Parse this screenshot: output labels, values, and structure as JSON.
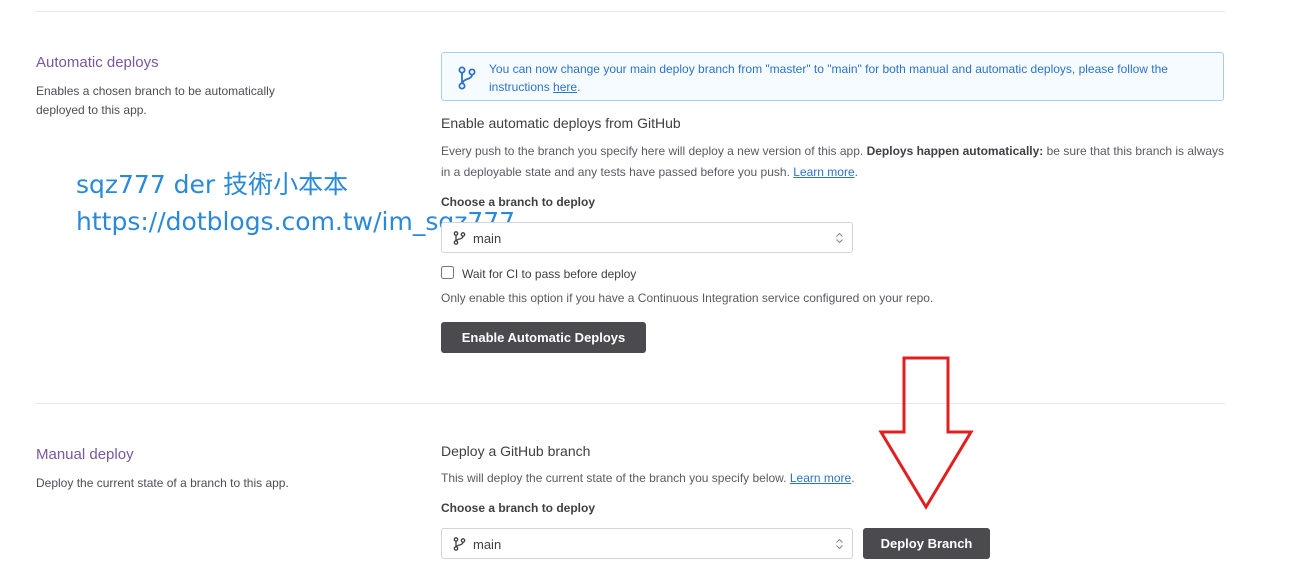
{
  "automatic": {
    "title": "Automatic deploys",
    "description": "Enables a chosen branch to be automatically deployed to this app.",
    "info": {
      "text": "You can now change your main deploy branch from \"master\" to \"main\" for both manual and automatic deploys, please follow the instructions ",
      "link": "here",
      "end": "."
    },
    "heading": "Enable automatic deploys from GitHub",
    "paragraph": {
      "text1": "Every push to the branch you specify here will deploy a new version of this app. ",
      "bold": "Deploys happen automatically:",
      "text2": " be sure that this branch is always in a deployable state and any tests have passed before you push. ",
      "link": "Learn more",
      "end": "."
    },
    "branch_label": "Choose a branch to deploy",
    "branch_value": "main",
    "checkbox_label": "Wait for CI to pass before deploy",
    "checkbox_checked": false,
    "hint": "Only enable this option if you have a Continuous Integration service configured on your repo.",
    "button": "Enable Automatic Deploys"
  },
  "watermark": {
    "line1": "sqz777 der 技術小本本",
    "line2": "https://dotblogs.com.tw/im_sqz777"
  },
  "manual": {
    "title": "Manual deploy",
    "description": "Deploy the current state of a branch to this app.",
    "heading": "Deploy a GitHub branch",
    "paragraph": {
      "text1": "This will deploy the current state of the branch you specify below. ",
      "link": "Learn more",
      "end": "."
    },
    "branch_label": "Choose a branch to deploy",
    "branch_value": "main",
    "button": "Deploy Branch"
  },
  "colors": {
    "accent_purple": "#79589f",
    "link_blue": "#2b73c8",
    "button_dark": "#4a4a4f",
    "annotation_red": "#e02020",
    "watermark_blue": "#2b8ad8"
  },
  "icons": [
    "branch-icon",
    "chevron-updown-icon",
    "down-arrow-annotation"
  ]
}
